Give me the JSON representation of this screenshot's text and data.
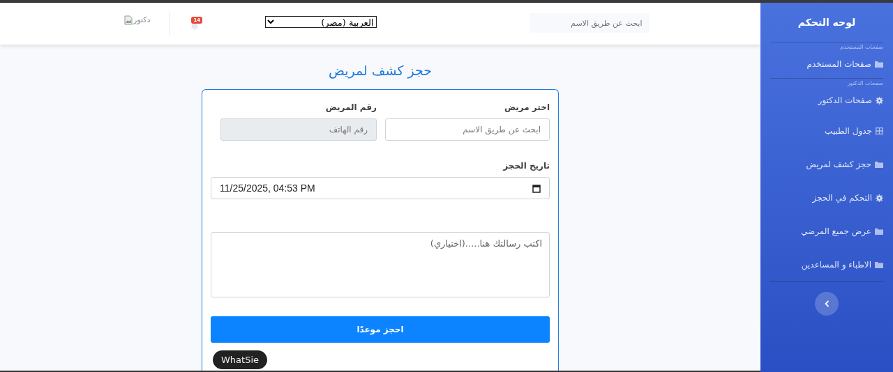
{
  "header": {
    "search": {
      "placeholder": "ابحث عن طريق الاسم"
    },
    "language": {
      "value": "العربية (مصر)"
    },
    "notifications": {
      "count": "14"
    },
    "avatar": {
      "alt": "دكتور"
    }
  },
  "sidebar": {
    "title": "لوحه التحكم",
    "sections": [
      {
        "heading": "صفحات المستخدم",
        "items": [
          {
            "label": "صفحات المستخدم",
            "kind": "folder"
          }
        ]
      },
      {
        "heading": "صفحات الدكتور",
        "items": [
          {
            "label": "صفحات الدكتور",
            "kind": "gear"
          },
          {
            "label": "جدول الطبيب",
            "kind": "table"
          },
          {
            "label": "حجز كشف لمريض",
            "kind": "folder"
          },
          {
            "label": "التحكم في الحجز",
            "kind": "gear"
          },
          {
            "label": "عرض جميع المرضي",
            "kind": "folder"
          },
          {
            "label": "الاطباء و المساعدين",
            "kind": "folder"
          }
        ]
      }
    ]
  },
  "page": {
    "title": "حجز كشف لمريض"
  },
  "form": {
    "patient": {
      "label": "اختر مريض",
      "placeholder": "ابحث عن طريق الاسم"
    },
    "phone": {
      "label": "رقم المريض",
      "placeholder": "رقم الهاتف",
      "disabled": true
    },
    "date": {
      "label": "تاريخ الحجز",
      "value": "11/25/2025, 04:53 PM"
    },
    "message": {
      "placeholder": "اكتب رسالتك هنا.....(اختياري)"
    },
    "submit": "احجز موعدًا"
  },
  "tooltip": {
    "text": "WhatSie"
  }
}
